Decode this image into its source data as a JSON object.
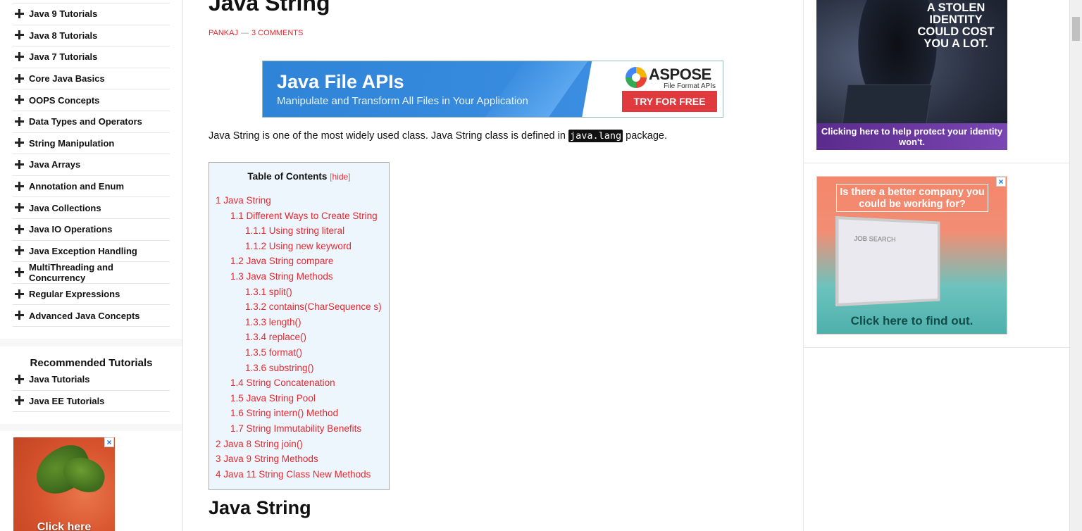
{
  "sidebar": {
    "categories": [
      "Java 9 Tutorials",
      "Java 8 Tutorials",
      "Java 7 Tutorials",
      "Core Java Basics",
      "OOPS Concepts",
      "Data Types and Operators",
      "String Manipulation",
      "Java Arrays",
      "Annotation and Enum",
      "Java Collections",
      "Java IO Operations",
      "Java Exception Handling",
      "MultiThreading and Concurrency",
      "Regular Expressions",
      "Advanced Java Concepts"
    ],
    "recommended_title": "Recommended Tutorials",
    "recommended": [
      "Java Tutorials",
      "Java EE Tutorials"
    ],
    "ad_cta": "Click here"
  },
  "article": {
    "title": "Java String",
    "author": "PANKAJ",
    "separator": "—",
    "comments": "3 COMMENTS",
    "intro_before": "Java String is one of the most widely used class. Java String class is defined in ",
    "intro_code": "java.lang",
    "intro_after": " package.",
    "section_heading": "Java String"
  },
  "banner": {
    "title": "Java File APIs",
    "subtitle": "Manipulate and Transform All Files in Your Application",
    "brand": "ASPOSE",
    "brand_tag": "File Format APIs",
    "button": "TRY FOR FREE"
  },
  "toc": {
    "title": "Table of Contents",
    "hide_open": "[",
    "hide_label": "hide",
    "hide_close": "]",
    "items": [
      {
        "level": 1,
        "label": "1 Java String"
      },
      {
        "level": 2,
        "label": "1.1 Different Ways to Create String"
      },
      {
        "level": 3,
        "label": "1.1.1 Using string literal"
      },
      {
        "level": 3,
        "label": "1.1.2 Using new keyword"
      },
      {
        "level": 2,
        "label": "1.2 Java String compare"
      },
      {
        "level": 2,
        "label": "1.3 Java String Methods"
      },
      {
        "level": 3,
        "label": "1.3.1 split()"
      },
      {
        "level": 3,
        "label": "1.3.2 contains(CharSequence s)"
      },
      {
        "level": 3,
        "label": "1.3.3 length()"
      },
      {
        "level": 3,
        "label": "1.3.4 replace()"
      },
      {
        "level": 3,
        "label": "1.3.5 format()"
      },
      {
        "level": 3,
        "label": "1.3.6 substring()"
      },
      {
        "level": 2,
        "label": "1.4 String Concatenation"
      },
      {
        "level": 2,
        "label": "1.5 Java String Pool"
      },
      {
        "level": 2,
        "label": "1.6 String intern() Method"
      },
      {
        "level": 2,
        "label": "1.7 String Immutability Benefits"
      },
      {
        "level": 1,
        "label": "2 Java 8 String join()"
      },
      {
        "level": 1,
        "label": "3 Java 9 String Methods"
      },
      {
        "level": 1,
        "label": "4 Java 11 String Class New Methods"
      }
    ]
  },
  "right_ads": {
    "identity_headline": "A STOLEN IDENTITY COULD COST YOU A LOT.",
    "identity_footer": "Clicking here to help protect your identity won't.",
    "job_question": "Is there a better company you could be working for?",
    "job_screen_text": "JOB SEARCH",
    "job_cta": "Click here to find out."
  },
  "icons": {
    "category": "plus-icon",
    "close": "close-icon"
  },
  "colors": {
    "link_red": "#e8272e",
    "toc_bg": "#eef6fd",
    "banner_blue": "#2f84d8",
    "button_red": "#e0393e"
  }
}
